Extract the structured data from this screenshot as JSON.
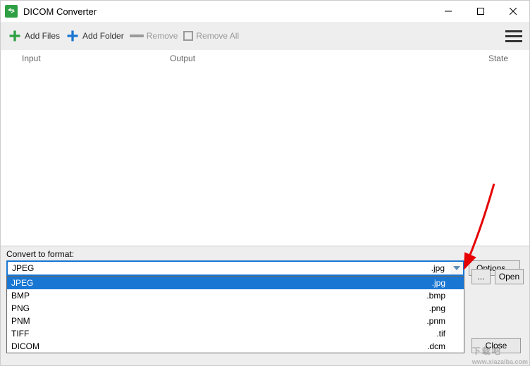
{
  "window": {
    "title": "DICOM Converter"
  },
  "toolbar": {
    "add_files": "Add Files",
    "add_folder": "Add Folder",
    "remove": "Remove",
    "remove_all": "Remove All"
  },
  "columns": {
    "input": "Input",
    "output": "Output",
    "state": "State"
  },
  "format": {
    "label": "Convert to format:",
    "selected_name": "JPEG",
    "selected_ext": ".jpg",
    "options": [
      {
        "name": "JPEG",
        "ext": ".jpg",
        "selected": true
      },
      {
        "name": "BMP",
        "ext": ".bmp",
        "selected": false
      },
      {
        "name": "PNG",
        "ext": ".png",
        "selected": false
      },
      {
        "name": "PNM",
        "ext": ".pnm",
        "selected": false
      },
      {
        "name": "TIFF",
        "ext": ".tif",
        "selected": false
      },
      {
        "name": "DICOM",
        "ext": ".dcm",
        "selected": false
      }
    ]
  },
  "buttons": {
    "options": "Options...",
    "browse": "...",
    "open": "Open",
    "close": "Close"
  },
  "watermark": {
    "text": "下载吧",
    "url": "www.xiazaiba.com"
  }
}
